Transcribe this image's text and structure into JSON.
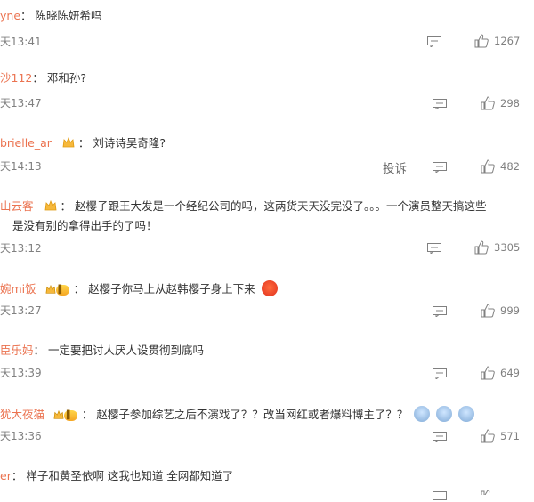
{
  "comments": [
    {
      "user": "yne",
      "colon": "：",
      "text": "陈晓陈妍希吗",
      "time": "天13:41",
      "likes": "1267"
    },
    {
      "user": "沙112",
      "colon": "：",
      "text": "邓和孙?",
      "time": "天13:47",
      "likes": "298"
    },
    {
      "user": "brielle_ar",
      "colon": "：",
      "text": "刘诗诗吴奇隆?",
      "time": "天14:13",
      "likes": "482",
      "report": "投诉"
    },
    {
      "user": "山云客",
      "colon": "：",
      "text": "赵樱子跟王大发是一个经纪公司的吗，这两货天天没完没了。。。一个演员整天搞这些",
      "text2": "是没有别的拿得出手的了吗！",
      "time": "天13:12",
      "likes": "3305"
    },
    {
      "user": "婉mi饭",
      "colon": "：",
      "text": "赵樱子你马上从赵韩樱子身上下来",
      "time": "天13:27",
      "likes": "999"
    },
    {
      "user": "臣乐妈",
      "colon": "：",
      "text": "一定要把讨人厌人设贯彻到底吗",
      "time": "天13:39",
      "likes": "649"
    },
    {
      "user": "犹大夜猫",
      "colon": "：",
      "text": "赵樱子参加综艺之后不演戏了？？改当网红或者爆料博主了？？",
      "time": "天13:36",
      "likes": "571"
    },
    {
      "user": "er",
      "colon": "：",
      "text": "样子和黄圣依啊 这我也知道 全网都知道了",
      "time": "",
      "likes": ""
    }
  ],
  "icons": {
    "reply": "comment-bubble-icon",
    "like": "thumbs-up-icon",
    "crown": "crown-icon",
    "vip": "vip-level-icon",
    "emoji": "shocked-emoji-icon"
  },
  "colors": {
    "username": "#eb7350",
    "meta": "#808080",
    "text": "#333333"
  }
}
